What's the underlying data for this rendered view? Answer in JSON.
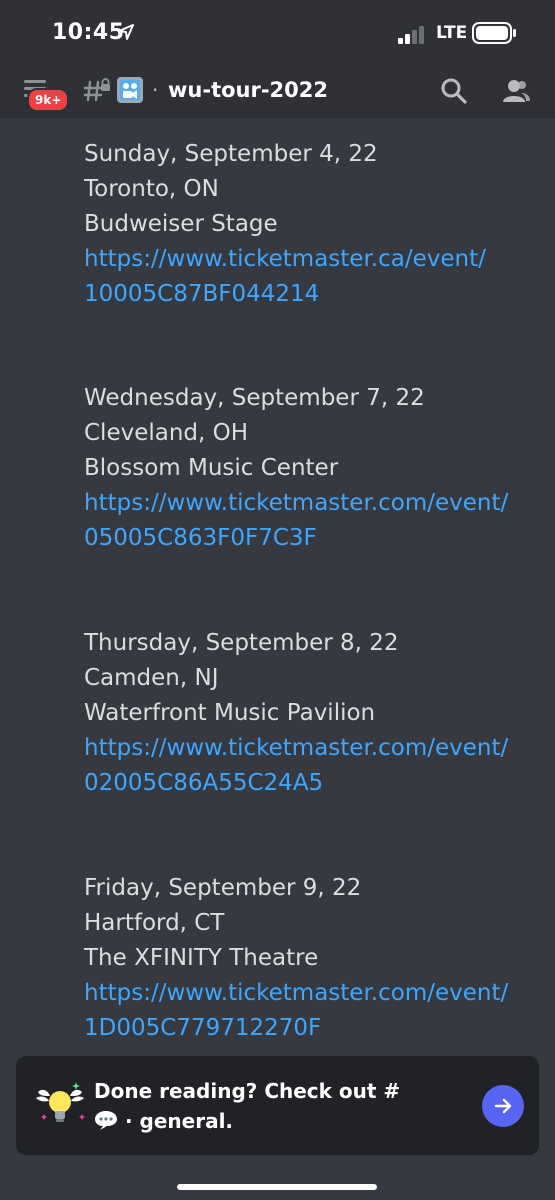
{
  "status_bar": {
    "time": "10:45",
    "network": "LTE"
  },
  "header": {
    "unread_badge": "9k+",
    "channel_name": "wu-tour-2022",
    "separator": "·",
    "icons": [
      "menu-icon",
      "locked-hash-icon",
      "film-frame-emoji-icon",
      "search-icon",
      "members-icon"
    ]
  },
  "events": [
    {
      "date": "Sunday, September 4, 22",
      "city": "Toronto, ON",
      "venue": "Budweiser Stage",
      "link_line1": "https://www.ticketmaster.ca/event/",
      "link_line2": "10005C87BF044214"
    },
    {
      "date": "Wednesday, September 7, 22",
      "city": "Cleveland, OH",
      "venue": "Blossom Music Center",
      "link_line1": "https://www.ticketmaster.com/event/",
      "link_line2": "05005C863F0F7C3F"
    },
    {
      "date": "Thursday, September 8, 22",
      "city": "Camden, NJ",
      "venue": "Waterfront Music Pavilion",
      "link_line1": "https://www.ticketmaster.com/event/",
      "link_line2": "02005C86A55C24A5"
    },
    {
      "date": "Friday, September 9, 22",
      "city": "Hartford, CT",
      "venue": "The XFINITY Theatre",
      "link_line1": "https://www.ticketmaster.com/event/",
      "link_line2": "1D005C779712270F"
    }
  ],
  "cta": {
    "text_prefix": "Done reading? Check out #",
    "text_suffix": " · general.",
    "icons": [
      "winged-lightbulb-icon",
      "speech-bubble-emoji-icon",
      "arrow-right-icon"
    ]
  },
  "colors": {
    "background": "#36393f",
    "header": "#2f3136",
    "link": "#3ea6ff",
    "badge": "#ed4245",
    "accent": "#5865f2"
  }
}
